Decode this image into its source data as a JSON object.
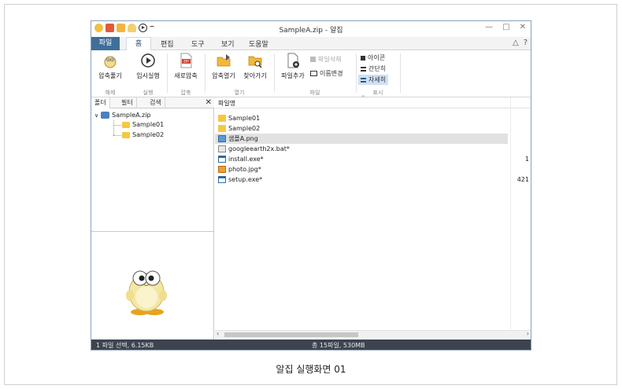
{
  "window": {
    "title": "SampleA.zip - 알집",
    "controls": [
      "—",
      "□",
      "✕"
    ]
  },
  "menu": {
    "file": "파일",
    "tabs": [
      "홈",
      "편집",
      "도구",
      "보기",
      "도움말"
    ],
    "right_icons": [
      "△",
      "?"
    ]
  },
  "ribbon": {
    "extract": "압축풀기",
    "temp_run": "임시실행",
    "new_archive": "새로압축",
    "open_archive": "압축열기",
    "find": "찾아가기",
    "add_file": "파일추가",
    "delete_file": "파일삭제",
    "rename": "이름변경",
    "view_icon": "아이콘",
    "view_simple": "간단히",
    "view_detail": "자세히",
    "groups": [
      "해제",
      "실행",
      "압축",
      "열기",
      "파일",
      "표시"
    ]
  },
  "left_panel": {
    "tabs": [
      "폴더",
      "필터",
      "검색"
    ],
    "close": "✕",
    "tree": {
      "root": "SampleA.zip",
      "children": [
        "Sample01",
        "Sample02"
      ]
    }
  },
  "file_list": {
    "column_name": "파일명",
    "files": [
      {
        "name": "Sample01",
        "type": "folder",
        "size": ""
      },
      {
        "name": "Sample02",
        "type": "folder",
        "size": ""
      },
      {
        "name": "샘플A.png",
        "type": "png",
        "size": ""
      },
      {
        "name": "googleearth2x.bat*",
        "type": "bat",
        "size": ""
      },
      {
        "name": "install.exe*",
        "type": "exe",
        "size": "1"
      },
      {
        "name": "photo.jpg*",
        "type": "jpg",
        "size": ""
      },
      {
        "name": "setup.exe*",
        "type": "exe",
        "size": "421"
      }
    ],
    "selected_index": 2
  },
  "status": {
    "left": "1 파일 선택, 6.15KB",
    "center": "총 15파일, 530MB"
  },
  "caption": "알집 실행화면 01",
  "colors": {
    "file_tab": "#3f6f99",
    "statusbar": "#3d4450",
    "folder": "#f5c842",
    "selection": "#e1e1e1"
  }
}
